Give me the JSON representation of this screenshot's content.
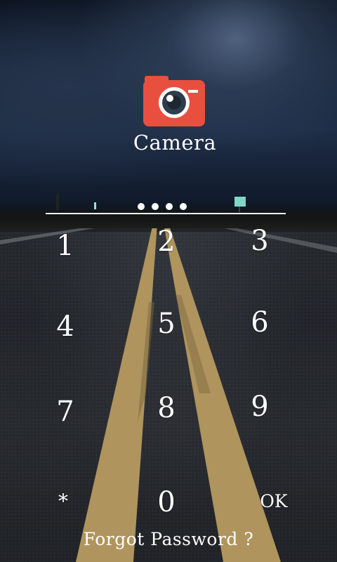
{
  "app": {
    "name": "Camera",
    "icon": "camera-icon",
    "icon_color": "#e94f3f"
  },
  "pin": {
    "entered_digits": 4
  },
  "keypad": {
    "keys": [
      "1",
      "2",
      "3",
      "4",
      "5",
      "6",
      "7",
      "8",
      "9",
      "*",
      "0",
      "OK"
    ]
  },
  "forgot_password_label": "Forgot Password ?"
}
